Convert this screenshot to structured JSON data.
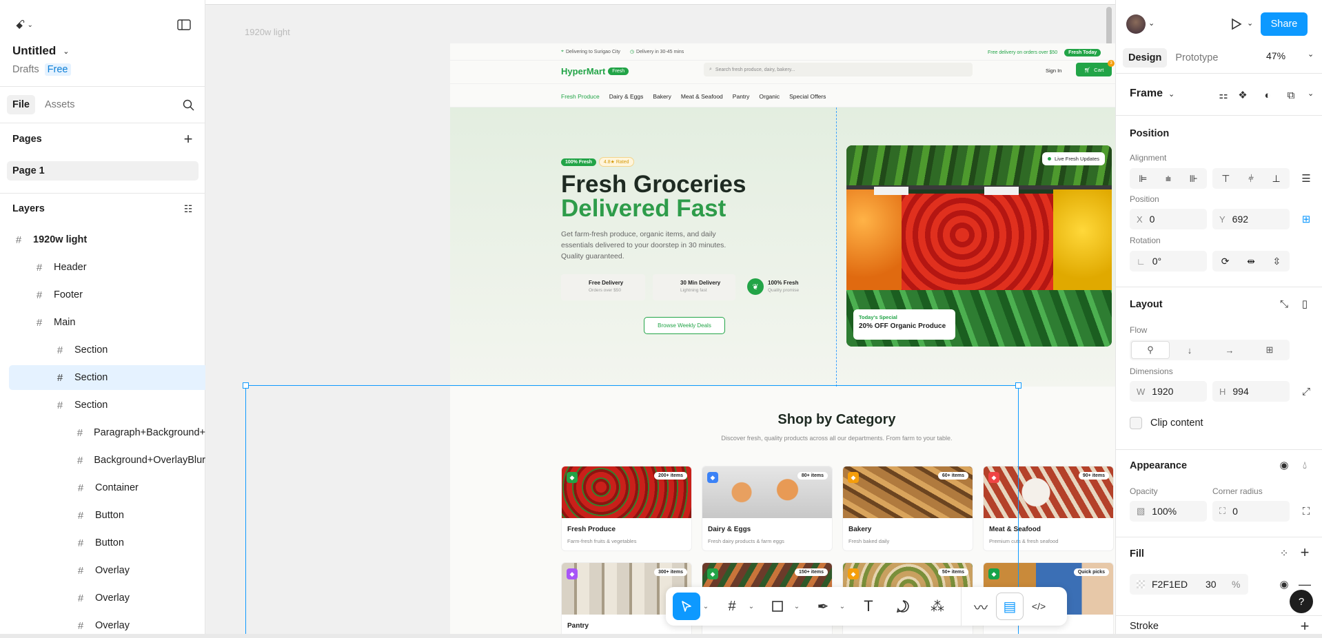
{
  "left_panel": {
    "file_title": "Untitled",
    "drafts_label": "Drafts",
    "plan_badge": "Free",
    "tab_file": "File",
    "tab_assets": "Assets",
    "pages_title": "Pages",
    "page_item": "Page 1",
    "layers_title": "Layers",
    "layers": [
      {
        "label": "1920w light",
        "indent": 0,
        "bold": true
      },
      {
        "label": "Header",
        "indent": 1
      },
      {
        "label": "Footer",
        "indent": 1
      },
      {
        "label": "Main",
        "indent": 1
      },
      {
        "label": "Section",
        "indent": 2
      },
      {
        "label": "Section",
        "indent": 2,
        "selected": true
      },
      {
        "label": "Section",
        "indent": 2
      },
      {
        "label": "Paragraph+Background+",
        "indent": 3
      },
      {
        "label": "Background+OverlayBlur",
        "indent": 3
      },
      {
        "label": "Container",
        "indent": 3
      },
      {
        "label": "Button",
        "indent": 3
      },
      {
        "label": "Button",
        "indent": 3
      },
      {
        "label": "Overlay",
        "indent": 3
      },
      {
        "label": "Overlay",
        "indent": 3
      },
      {
        "label": "Overlay",
        "indent": 3
      }
    ]
  },
  "canvas": {
    "frame_label": "1920w light",
    "site": {
      "topbar_location": "Delivering to Surigao City",
      "topbar_delivery": "Delivery in 30-45 mins",
      "topbar_free": "Free delivery on orders over $50",
      "topbar_badge": "Fresh Today",
      "logo": "HyperMart",
      "logo_badge": "Fresh",
      "search_placeholder": "Search fresh produce, dairy, bakery...",
      "sign_in": "Sign In",
      "cart": "Cart",
      "cart_count": "3",
      "nav": [
        "Fresh Produce",
        "Dairy & Eggs",
        "Bakery",
        "Meat & Seafood",
        "Pantry",
        "Organic",
        "Special Offers"
      ],
      "hero_badge1": "100% Fresh",
      "hero_badge2": "4.8★ Rated",
      "hero_title1": "Fresh Groceries",
      "hero_title2": "Delivered Fast",
      "hero_desc": "Get farm-fresh produce, organic items, and daily essentials delivered to your doorstep in 30 minutes. Quality guaranteed.",
      "features": [
        {
          "title": "Free Delivery",
          "sub": "Orders over $50"
        },
        {
          "title": "30 Min Delivery",
          "sub": "Lightning fast"
        },
        {
          "title": "100% Fresh",
          "sub": "Quality promise"
        }
      ],
      "hero_button": "Browse Weekly Deals",
      "live_badge": "Live Fresh Updates",
      "special_label": "Today's Special",
      "special_text": "20% OFF Organic Produce",
      "shop_title": "Shop by Category",
      "shop_sub": "Discover fresh, quality products across all our departments. From farm to your table.",
      "categories": [
        {
          "title": "Fresh Produce",
          "desc": "Farm-fresh fruits & vegetables",
          "badge": "200+ items",
          "color": "#22a447"
        },
        {
          "title": "Dairy & Eggs",
          "desc": "Fresh dairy products & farm eggs",
          "badge": "80+ items",
          "color": "#3b82f6"
        },
        {
          "title": "Bakery",
          "desc": "Fresh baked daily",
          "badge": "60+ items",
          "color": "#f59e0b"
        },
        {
          "title": "Meat & Seafood",
          "desc": "Premium cuts & fresh seafood",
          "badge": "90+ items",
          "color": "#ef4444"
        },
        {
          "title": "Pantry",
          "desc": "",
          "badge": "300+ items",
          "color": "#a855f7"
        },
        {
          "title": "",
          "desc": "",
          "badge": "150+ items",
          "color": "#22a447"
        },
        {
          "title": "",
          "desc": "",
          "badge": "50+ items",
          "color": "#f59e0b"
        },
        {
          "title": "",
          "desc": "",
          "badge": "Quick picks",
          "color": "#16a34a"
        }
      ]
    }
  },
  "right_panel": {
    "tab_design": "Design",
    "tab_prototype": "Prototype",
    "zoom": "47%",
    "share": "Share",
    "frame_type": "Frame",
    "position_title": "Position",
    "alignment_label": "Alignment",
    "position_label": "Position",
    "x_label": "X",
    "x_value": "0",
    "y_label": "Y",
    "y_value": "692",
    "rotation_label": "Rotation",
    "rotation_value": "0°",
    "layout_title": "Layout",
    "flow_label": "Flow",
    "dimensions_label": "Dimensions",
    "w_label": "W",
    "w_value": "1920",
    "h_label": "H",
    "h_value": "994",
    "clip_label": "Clip content",
    "appearance_title": "Appearance",
    "opacity_label": "Opacity",
    "opacity_value": "100%",
    "radius_label": "Corner radius",
    "radius_value": "0",
    "fill_title": "Fill",
    "fill_hex": "F2F1ED",
    "fill_opacity": "30",
    "fill_pct": "%",
    "stroke_title": "Stroke"
  },
  "colors": {
    "accent": "#0d99ff",
    "brand_green": "#22a447",
    "selection": "#e5f2ff"
  }
}
